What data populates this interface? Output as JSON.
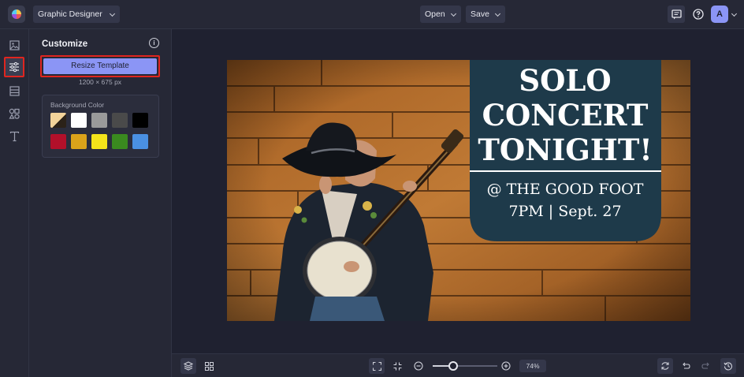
{
  "topbar": {
    "app_select_label": "Graphic Designer",
    "open_label": "Open",
    "save_label": "Save",
    "avatar_initial": "A",
    "icons": [
      "comment-icon",
      "help-icon"
    ]
  },
  "rail": {
    "items": [
      {
        "name": "image-icon",
        "active": false
      },
      {
        "name": "sliders-icon",
        "active": true
      },
      {
        "name": "layout-icon",
        "active": false
      },
      {
        "name": "graphics-icon",
        "active": false
      },
      {
        "name": "text-icon",
        "active": false
      }
    ]
  },
  "panel": {
    "title": "Customize",
    "info_glyph": "i",
    "resize_label": "Resize Template",
    "dims": "1200 × 675 px",
    "background_label": "Background Color",
    "swatches": [
      "#f2d39a",
      "#ffffff",
      "#9a9a9a",
      "#4a4a4a",
      "#000000",
      "#b2102a",
      "#dba31a",
      "#f4e41a",
      "#3a8a1f",
      "#4a90e2"
    ]
  },
  "design": {
    "headline_lines": [
      "SOLO",
      "CONCERT",
      "TONIGHT!"
    ],
    "venue": "@ THE GOOD FOOT",
    "time": "7PM | Sept. 27",
    "panel_color": "#1e3a4a",
    "wood_color": "#b56f2c"
  },
  "bottombar": {
    "zoom_value": "74%",
    "zoom_level": 0.32
  }
}
